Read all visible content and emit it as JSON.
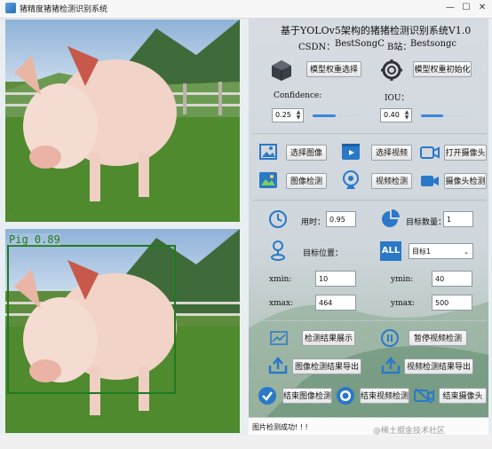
{
  "window": {
    "title": "猪精度猪猪检测识别系统"
  },
  "header": {
    "title": "基于YOLOv5架构的猪猪检测识别系统V1.0",
    "csdn_label": "CSDN：",
    "csdn_value": "BestSongC",
    "bilibili_label": "B站：",
    "bilibili_value": "Bestsongc"
  },
  "model": {
    "select_label": "模型权重选择",
    "init_label": "模型权重初始化",
    "confidence_label": "Confidence:",
    "confidence_value": "0.25",
    "confidence_level": 0.25,
    "iou_label": "IOU：",
    "iou_value": "0.40",
    "iou_level": 0.4
  },
  "actions": {
    "select_image": "选择图像",
    "select_video": "选择视频",
    "open_camera": "打开摄像头",
    "image_detect": "图像检测",
    "video_detect": "视频检测",
    "camera_detect": "摄像头检测"
  },
  "results": {
    "time_label": "用时：",
    "time_value": "0.95",
    "count_label": "目标数量：",
    "count_value": "1",
    "position_label": "目标位置：",
    "target_selected": "目标1",
    "xmin_label": "xmin:",
    "xmin_value": "10",
    "ymin_label": "ymin:",
    "ymin_value": "40",
    "xmax_label": "xmax:",
    "xmax_value": "464",
    "ymax_label": "ymax:",
    "ymax_value": "500"
  },
  "controls": {
    "show_results": "检测结果展示",
    "pause_video": "暂停视频检测",
    "export_image": "图像检测结果导出",
    "export_video": "视频检测结果导出",
    "end_image": "结束图像检测",
    "end_video": "结束视频检测",
    "end_camera": "结束摄像头"
  },
  "status": {
    "message": "图片检测成功! ! !"
  },
  "detection": {
    "label": "Pig  0.89"
  },
  "watermark": "@稀土掘金技术社区",
  "colors": {
    "accent": "#3b87d8",
    "box": "#1f7a1f"
  }
}
